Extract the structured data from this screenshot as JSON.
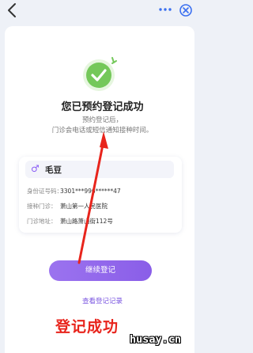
{
  "header": {
    "back_icon": "chevron-left-icon",
    "more_icon": "ellipsis-icon",
    "close_icon": "close-circle-icon"
  },
  "success": {
    "title": "您已预约登记成功",
    "line1": "预约登记后，",
    "line2": "门诊会电话或短信通知接种时间。"
  },
  "patient": {
    "gender_icon": "male-icon",
    "name": "毛豆",
    "id_label": "身份证号码：",
    "id_value": "3301***996******47",
    "clinic_label": "接种门诊：",
    "clinic_value": "萧山第一人民医院",
    "address_label": "门诊地址：",
    "address_value": "萧山路萧山街112号"
  },
  "actions": {
    "continue_label": "继续登记",
    "view_records_label": "查看登记记录"
  },
  "annotation": {
    "caption": "登记成功"
  },
  "watermark": "husay.cn",
  "colors": {
    "accent": "#8a5ee8",
    "success": "#74c85a",
    "annotation": "#e8241c"
  }
}
